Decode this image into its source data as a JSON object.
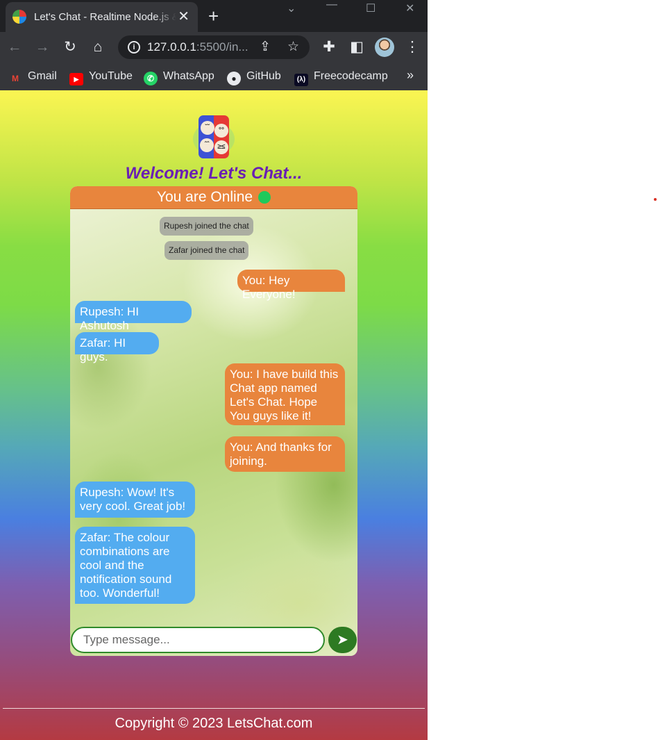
{
  "browser": {
    "tab_title": "Let's Chat - Realtime Node.js & Socket.io",
    "new_tab_symbol": "+",
    "close_symbol": "✕",
    "url_host": "127.0.0.1",
    "url_rest": ":5500/in...",
    "bookmarks": [
      {
        "label": "Gmail",
        "icon": "gmail-icon"
      },
      {
        "label": "YouTube",
        "icon": "youtube-icon"
      },
      {
        "label": "WhatsApp",
        "icon": "whatsapp-icon"
      },
      {
        "label": "GitHub",
        "icon": "github-icon"
      },
      {
        "label": "Freecodecamp",
        "icon": "freecodecamp-icon"
      }
    ],
    "bookmarks_more": "»"
  },
  "page": {
    "welcome": "Welcome! Let's Chat...",
    "status": "You are Online",
    "notices": [
      "Rupesh joined the chat",
      "Zafar joined the chat"
    ],
    "messages": [
      {
        "side": "right",
        "text": "You: Hey Everyone!"
      },
      {
        "side": "left",
        "text": "Rupesh: HI Ashutosh"
      },
      {
        "side": "left",
        "text": "Zafar: HI guys."
      },
      {
        "side": "right",
        "text": "You: I have build this Chat app named Let's Chat. Hope You guys like it!"
      },
      {
        "side": "right",
        "text": "You: And thanks for joining."
      },
      {
        "side": "left",
        "text": "Rupesh: Wow! It's very cool. Great job!"
      },
      {
        "side": "left",
        "text": "Zafar: The colour combinations are cool and the notification sound too. Wonderful!"
      }
    ],
    "input_placeholder": "Type message...",
    "send_icon": "send-arrow-icon",
    "copyright": "Copyright © 2023 LetsChat.com"
  },
  "colors": {
    "header": "#e8853d",
    "own_message": "#e8853d",
    "other_message": "#53acf0",
    "online_dot": "#1fc95b",
    "welcome_text": "#6a1fb4",
    "send_button": "#2d7a22"
  }
}
